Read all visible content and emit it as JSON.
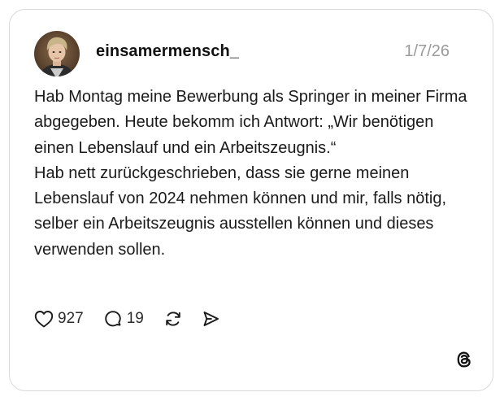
{
  "post": {
    "username": "einsamermensch_",
    "date": "1/7/26",
    "body_lines": [
      "Hab Montag meine Bewerbung als Springer in meiner Firma abgegeben. Heute bekomm ich Antwort: „Wir benötigen einen Lebenslauf und ein Arbeitszeugnis.“",
      "Hab nett zurückgeschrieben, dass sie gerne meinen Lebenslauf von 2024 nehmen können und mir, falls nötig, selber ein Arbeitszeugnis ausstellen können und dieses verwenden sollen."
    ]
  },
  "actions": {
    "likes": "927",
    "replies": "19"
  },
  "icons": {
    "like": "heart-icon",
    "reply": "comment-icon",
    "repost": "repost-icon",
    "share": "send-icon",
    "brand": "threads-logo-icon"
  },
  "colors": {
    "text": "#1a1a1a",
    "muted": "#9a9a9a",
    "border": "#d9d9d9"
  }
}
